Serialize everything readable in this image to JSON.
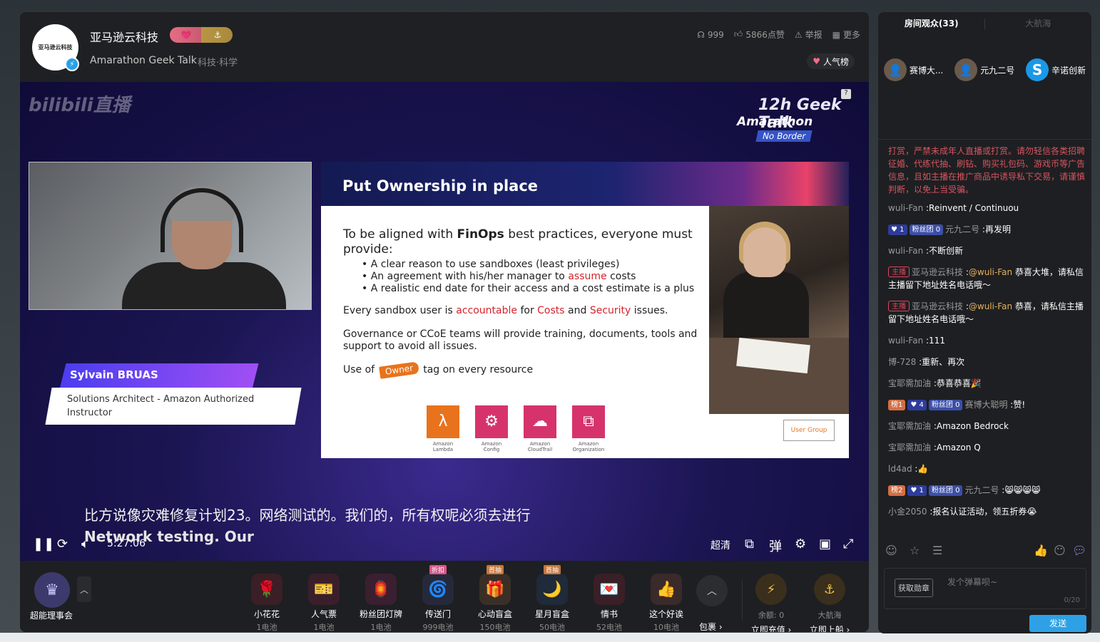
{
  "header": {
    "streamer_name": "亚马逊云科技",
    "avatar_text": "亚马逊云科技",
    "medal_left": "💗",
    "medal_right": "⚓",
    "room_title": "Amarathon Geek Talk",
    "room_category": "科技·科学",
    "stats": {
      "viewers": "999",
      "likes": "5866点赞",
      "report": "举报",
      "more": "更多"
    },
    "rank_label": "人气榜"
  },
  "video": {
    "watermark": "bilibili直播",
    "brand": {
      "line1": "12h Geek Talk",
      "line2": "Amarathon",
      "line3": "No Border",
      "help": "?"
    },
    "nameplate": {
      "name": "Sylvain BRUAS",
      "role": "Solutions Architect - Amazon Authorized Instructor"
    },
    "slide": {
      "title": "Put Ownership in place",
      "lead_pre": "To be aligned with ",
      "lead_bold": "FinOps",
      "lead_post": " best practices, everyone must provide:",
      "bullet1": "A clear reason to use sandboxes (least privileges)",
      "bullet2_pre": "An agreement with his/her manager to ",
      "bullet2_red": "assume",
      "bullet2_post": " costs",
      "bullet3": "A realistic end date for their access and a cost estimate is a plus",
      "p2_pre": "Every sandbox user is ",
      "p2_red1": "accountable",
      "p2_mid": " for ",
      "p2_red2": "Costs",
      "p2_and": " and ",
      "p2_red3": "Security",
      "p2_post": " issues.",
      "p3": "Governance or CCoE teams will provide training, documents, tools and support to avoid all issues.",
      "p4_pre": "Use of",
      "p4_tag": "Owner",
      "p4_post": "tag on every resource",
      "usergroup": "User Group",
      "services": [
        {
          "name": "Amazon Lambda",
          "color": "#e8731c",
          "glyph": "λ"
        },
        {
          "name": "Amazon Config",
          "color": "#d6336c",
          "glyph": "⚙"
        },
        {
          "name": "Amazon CloudTrail",
          "color": "#d6336c",
          "glyph": "☁"
        },
        {
          "name": "Amazon Organization",
          "color": "#d6336c",
          "glyph": "⧉"
        }
      ]
    },
    "subtitle_cn": "比方说像灾难修复计划23。网络测试的。我们的，所有权呢必须去进行",
    "subtitle_en": "Network testing. Our",
    "time": "5:27:06",
    "quality": "超清"
  },
  "giftbar": {
    "member_label": "超能理事会",
    "gifts": [
      {
        "name": "小花花",
        "price": "1电池",
        "glyph": "🌹",
        "bg": "#3a1f26",
        "tag": ""
      },
      {
        "name": "人气票",
        "price": "1电池",
        "glyph": "🎫",
        "bg": "#3a1f2a",
        "tag": ""
      },
      {
        "name": "粉丝团灯牌",
        "price": "1电池",
        "glyph": "🏮",
        "bg": "#3a1f30",
        "tag": ""
      },
      {
        "name": "传送门",
        "price": "999电池",
        "glyph": "🌀",
        "bg": "#26293a",
        "tag": "折扣"
      },
      {
        "name": "心动盲盒",
        "price": "150电池",
        "glyph": "🎁",
        "bg": "#3a2f26",
        "tag": "首抽"
      },
      {
        "name": "星月盲盒",
        "price": "50电池",
        "glyph": "🌙",
        "bg": "#1f2a3a",
        "tag": "首抽"
      },
      {
        "name": "情书",
        "price": "52电池",
        "glyph": "💌",
        "bg": "#3a1f26",
        "tag": ""
      },
      {
        "name": "这个好诶",
        "price": "10电池",
        "glyph": "👍",
        "bg": "#3a2a2a",
        "tag": ""
      }
    ],
    "package_label": "包裹 ›",
    "balance": "余额: 0",
    "recharge": "立即充值 ›",
    "voyage": "大航海",
    "board": "立即上船 ›"
  },
  "sidebar": {
    "tab_active": "房间观众(33)",
    "tab_inactive": "大航海",
    "viewers": [
      {
        "name": "赛博大...",
        "glyph": "👤"
      },
      {
        "name": "元九二号",
        "glyph": "👤"
      },
      {
        "name": "辛诺创新",
        "glyph": "S"
      }
    ],
    "notice": "打赏，严禁未成年人直播或打赏。请勿轻信各类招聘征婚、代练代抽、刷钻、购买礼包码、游戏币等广告信息，且如主播在推广商品中诱导私下交易，请谨慎判断，以免上当受骗。",
    "messages": [
      {
        "badges": [],
        "user": "wuli-Fan",
        "text": "Reinvent / Continuou"
      },
      {
        "badges": [
          {
            "cls": "b-lv",
            "t": "♥ 1"
          },
          {
            "cls": "b-fan",
            "t": "粉丝团 0"
          }
        ],
        "user": "元九二号",
        "text": "再发明"
      },
      {
        "badges": [],
        "user": "wuli-Fan",
        "text": "不断创新"
      },
      {
        "badges": [
          {
            "cls": "b-host",
            "t": "主播"
          }
        ],
        "user": "亚马逊云科技",
        "at": "@wuli-Fan",
        "text": "恭喜大堆，请私信主播留下地址姓名电话哦～"
      },
      {
        "badges": [
          {
            "cls": "b-host",
            "t": "主播"
          }
        ],
        "user": "亚马逊云科技",
        "at": "@wuli-Fan",
        "text": "恭喜，请私信主播留下地址姓名电话哦～"
      },
      {
        "badges": [],
        "user": "wuli-Fan",
        "text": "111"
      },
      {
        "badges": [],
        "user": "博-728",
        "text": "重新、再次"
      },
      {
        "badges": [],
        "user": "宝耶需加油",
        "text": "恭喜恭喜🎉"
      },
      {
        "badges": [
          {
            "cls": "b-rank",
            "t": "榜1"
          },
          {
            "cls": "b-lv",
            "t": "♥ 4"
          },
          {
            "cls": "b-fan",
            "t": "粉丝团 0"
          }
        ],
        "user": "赛博大聪明",
        "text": "赞!"
      },
      {
        "badges": [],
        "user": "宝耶需加油",
        "text": "Amazon Bedrock"
      },
      {
        "badges": [],
        "user": "宝耶需加油",
        "text": "Amazon Q"
      },
      {
        "badges": [],
        "user": "ld4ad",
        "text": "👍"
      },
      {
        "badges": [
          {
            "cls": "b-rank",
            "t": "榜2"
          },
          {
            "cls": "b-lv",
            "t": "♥ 1"
          },
          {
            "cls": "b-fan",
            "t": "粉丝团 0"
          }
        ],
        "user": "元九二号",
        "text": "😸😸😸😸"
      },
      {
        "badges": [],
        "user": "小金2050",
        "text": "报名认证活动，领五折券😭"
      }
    ],
    "medal_button": "获取勋章",
    "input_placeholder": "发个弹幕呗~",
    "input_count": "0/20",
    "send_label": "发送"
  }
}
